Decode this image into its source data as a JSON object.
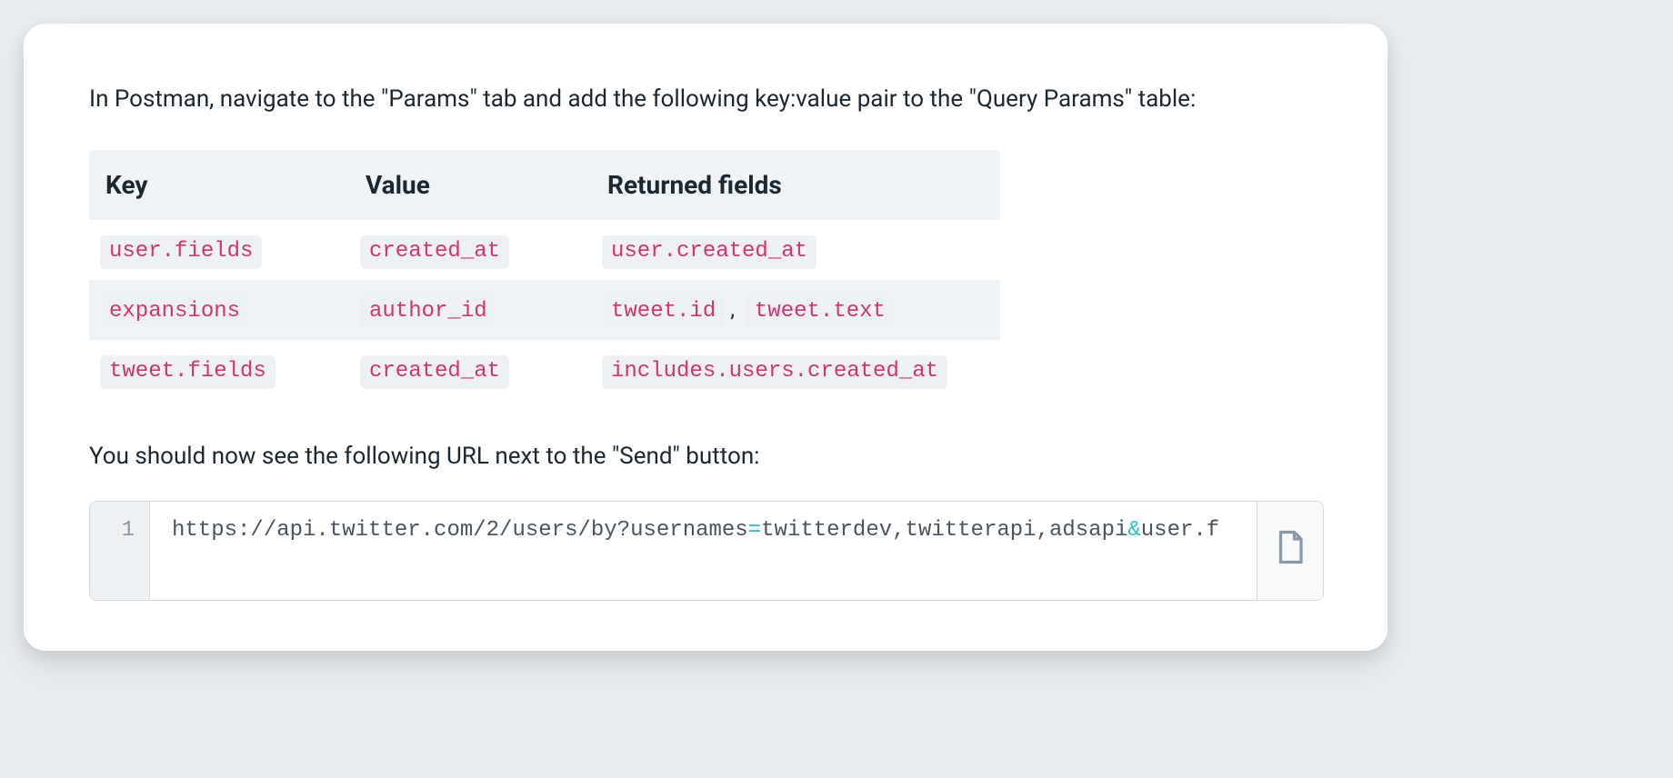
{
  "intro": "In Postman, navigate to the \"Params\" tab and add the following key:value pair to the \"Query Params\" table:",
  "table": {
    "headers": {
      "key": "Key",
      "value": "Value",
      "returned": "Returned fields"
    },
    "rows": [
      {
        "key": "user.fields",
        "value": "created_at",
        "returned": [
          "user.created_at"
        ]
      },
      {
        "key": "expansions",
        "value": "author_id",
        "returned": [
          "tweet.id",
          "tweet.text"
        ]
      },
      {
        "key": "tweet.fields",
        "value": "created_at",
        "returned": [
          "includes.users.created_at"
        ]
      }
    ]
  },
  "outro": "You should now see the following URL next to the \"Send\" button:",
  "code": {
    "lineno": "1",
    "segments": [
      {
        "t": "https://api.twitter.com/2/users/by?usernames",
        "c": ""
      },
      {
        "t": "=",
        "c": "eq"
      },
      {
        "t": "twitterdev,twitterapi,adsapi",
        "c": ""
      },
      {
        "t": "&",
        "c": "amp"
      },
      {
        "t": "user.f",
        "c": ""
      }
    ]
  },
  "separator": ","
}
